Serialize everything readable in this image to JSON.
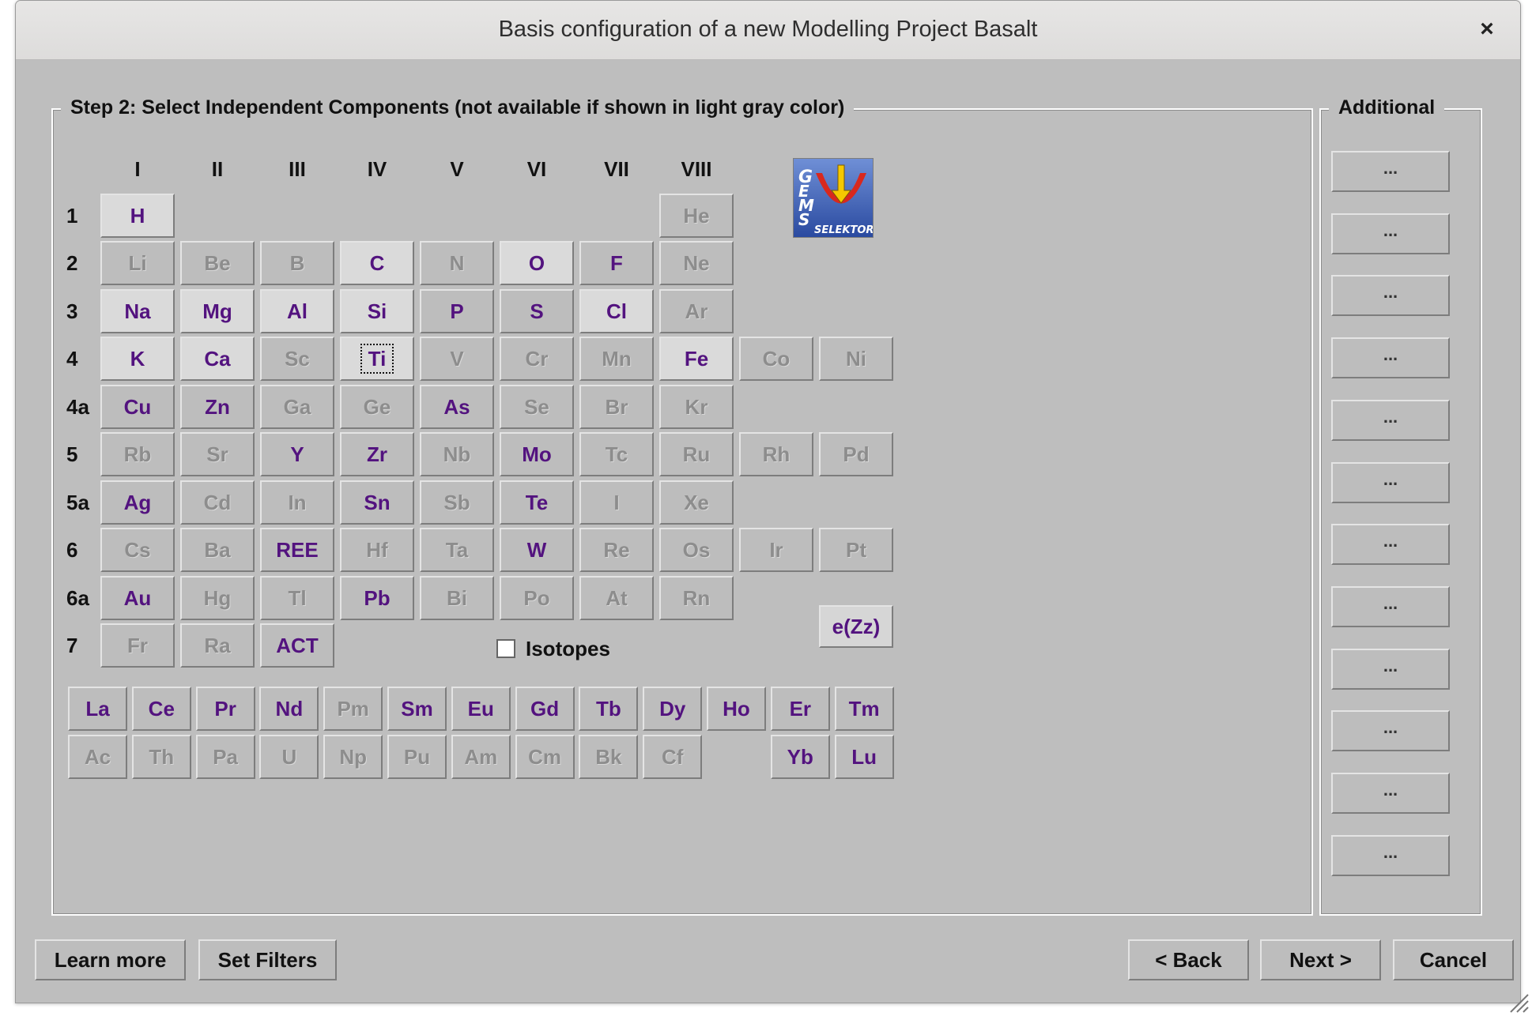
{
  "window": {
    "title": "Basis configuration of a new Modelling Project  Basalt",
    "close_glyph": "×"
  },
  "main_group": {
    "title": "Step 2: Select Independent Components (not available if shown in light gray color)"
  },
  "additional_group": {
    "title": "Additional",
    "button_label": "..."
  },
  "columns": [
    "I",
    "II",
    "III",
    "IV",
    "V",
    "VI",
    "VII",
    "VIII"
  ],
  "rows": [
    "1",
    "2",
    "3",
    "4",
    "4a",
    "5",
    "5a",
    "6",
    "6a",
    "7"
  ],
  "elements": [
    {
      "sym": "H",
      "state": "sel"
    },
    {
      "sym": "He",
      "state": "na"
    },
    {
      "sym": "Li",
      "state": "na"
    },
    {
      "sym": "Be",
      "state": "na"
    },
    {
      "sym": "B",
      "state": "na"
    },
    {
      "sym": "C",
      "state": "sel"
    },
    {
      "sym": "N",
      "state": "na"
    },
    {
      "sym": "O",
      "state": "sel"
    },
    {
      "sym": "F",
      "state": "avail"
    },
    {
      "sym": "Ne",
      "state": "na"
    },
    {
      "sym": "Na",
      "state": "sel"
    },
    {
      "sym": "Mg",
      "state": "sel"
    },
    {
      "sym": "Al",
      "state": "sel"
    },
    {
      "sym": "Si",
      "state": "sel"
    },
    {
      "sym": "P",
      "state": "avail"
    },
    {
      "sym": "S",
      "state": "avail"
    },
    {
      "sym": "Cl",
      "state": "sel"
    },
    {
      "sym": "Ar",
      "state": "na"
    },
    {
      "sym": "K",
      "state": "sel"
    },
    {
      "sym": "Ca",
      "state": "sel"
    },
    {
      "sym": "Sc",
      "state": "na"
    },
    {
      "sym": "Ti",
      "state": "sel"
    },
    {
      "sym": "V",
      "state": "na"
    },
    {
      "sym": "Cr",
      "state": "na"
    },
    {
      "sym": "Mn",
      "state": "na"
    },
    {
      "sym": "Fe",
      "state": "sel"
    },
    {
      "sym": "Co",
      "state": "na"
    },
    {
      "sym": "Ni",
      "state": "na"
    },
    {
      "sym": "Cu",
      "state": "avail"
    },
    {
      "sym": "Zn",
      "state": "avail"
    },
    {
      "sym": "Ga",
      "state": "na"
    },
    {
      "sym": "Ge",
      "state": "na"
    },
    {
      "sym": "As",
      "state": "avail"
    },
    {
      "sym": "Se",
      "state": "na"
    },
    {
      "sym": "Br",
      "state": "na"
    },
    {
      "sym": "Kr",
      "state": "na"
    },
    {
      "sym": "Rb",
      "state": "na"
    },
    {
      "sym": "Sr",
      "state": "na"
    },
    {
      "sym": "Y",
      "state": "avail"
    },
    {
      "sym": "Zr",
      "state": "avail"
    },
    {
      "sym": "Nb",
      "state": "na"
    },
    {
      "sym": "Mo",
      "state": "avail"
    },
    {
      "sym": "Tc",
      "state": "na"
    },
    {
      "sym": "Ru",
      "state": "na"
    },
    {
      "sym": "Rh",
      "state": "na"
    },
    {
      "sym": "Pd",
      "state": "na"
    },
    {
      "sym": "Ag",
      "state": "avail"
    },
    {
      "sym": "Cd",
      "state": "na"
    },
    {
      "sym": "In",
      "state": "na"
    },
    {
      "sym": "Sn",
      "state": "avail"
    },
    {
      "sym": "Sb",
      "state": "na"
    },
    {
      "sym": "Te",
      "state": "avail"
    },
    {
      "sym": "I",
      "state": "na"
    },
    {
      "sym": "Xe",
      "state": "na"
    },
    {
      "sym": "Cs",
      "state": "na"
    },
    {
      "sym": "Ba",
      "state": "na"
    },
    {
      "sym": "REE",
      "state": "avail"
    },
    {
      "sym": "Hf",
      "state": "na"
    },
    {
      "sym": "Ta",
      "state": "na"
    },
    {
      "sym": "W",
      "state": "avail"
    },
    {
      "sym": "Re",
      "state": "na"
    },
    {
      "sym": "Os",
      "state": "na"
    },
    {
      "sym": "Ir",
      "state": "na"
    },
    {
      "sym": "Pt",
      "state": "na"
    },
    {
      "sym": "Au",
      "state": "avail"
    },
    {
      "sym": "Hg",
      "state": "na"
    },
    {
      "sym": "Tl",
      "state": "na"
    },
    {
      "sym": "Pb",
      "state": "avail"
    },
    {
      "sym": "Bi",
      "state": "na"
    },
    {
      "sym": "Po",
      "state": "na"
    },
    {
      "sym": "At",
      "state": "na"
    },
    {
      "sym": "Rn",
      "state": "na"
    },
    {
      "sym": "Fr",
      "state": "na"
    },
    {
      "sym": "Ra",
      "state": "na"
    },
    {
      "sym": "ACT",
      "state": "avail"
    },
    {
      "sym": "e(Zz)",
      "state": "ezz"
    }
  ],
  "lanthanides": [
    {
      "sym": "La",
      "state": "avail"
    },
    {
      "sym": "Ce",
      "state": "avail"
    },
    {
      "sym": "Pr",
      "state": "avail"
    },
    {
      "sym": "Nd",
      "state": "avail"
    },
    {
      "sym": "Pm",
      "state": "na"
    },
    {
      "sym": "Sm",
      "state": "avail"
    },
    {
      "sym": "Eu",
      "state": "avail"
    },
    {
      "sym": "Gd",
      "state": "avail"
    },
    {
      "sym": "Tb",
      "state": "avail"
    },
    {
      "sym": "Dy",
      "state": "avail"
    },
    {
      "sym": "Ho",
      "state": "avail"
    },
    {
      "sym": "Er",
      "state": "avail"
    },
    {
      "sym": "Tm",
      "state": "avail"
    }
  ],
  "actinides": [
    {
      "sym": "Ac",
      "state": "na"
    },
    {
      "sym": "Th",
      "state": "na"
    },
    {
      "sym": "Pa",
      "state": "na"
    },
    {
      "sym": "U",
      "state": "na"
    },
    {
      "sym": "Np",
      "state": "na"
    },
    {
      "sym": "Pu",
      "state": "na"
    },
    {
      "sym": "Am",
      "state": "na"
    },
    {
      "sym": "Cm",
      "state": "na"
    },
    {
      "sym": "Bk",
      "state": "na"
    },
    {
      "sym": "Cf",
      "state": "na"
    },
    {
      "sym": "Yb",
      "state": "avail"
    },
    {
      "sym": "Lu",
      "state": "avail"
    }
  ],
  "focused_element": "Ti",
  "isotopes": {
    "label": "Isotopes",
    "checked": false
  },
  "logo": {
    "text": "GEMS",
    "subtext": "SELEKTOR"
  },
  "footer": {
    "learn_more": "Learn more",
    "set_filters": "Set Filters",
    "back": "< Back",
    "next": "Next >",
    "cancel": "Cancel"
  },
  "colors": {
    "available": "#53137f",
    "not_available": "#8d8d8d",
    "background": "#bebebe"
  }
}
